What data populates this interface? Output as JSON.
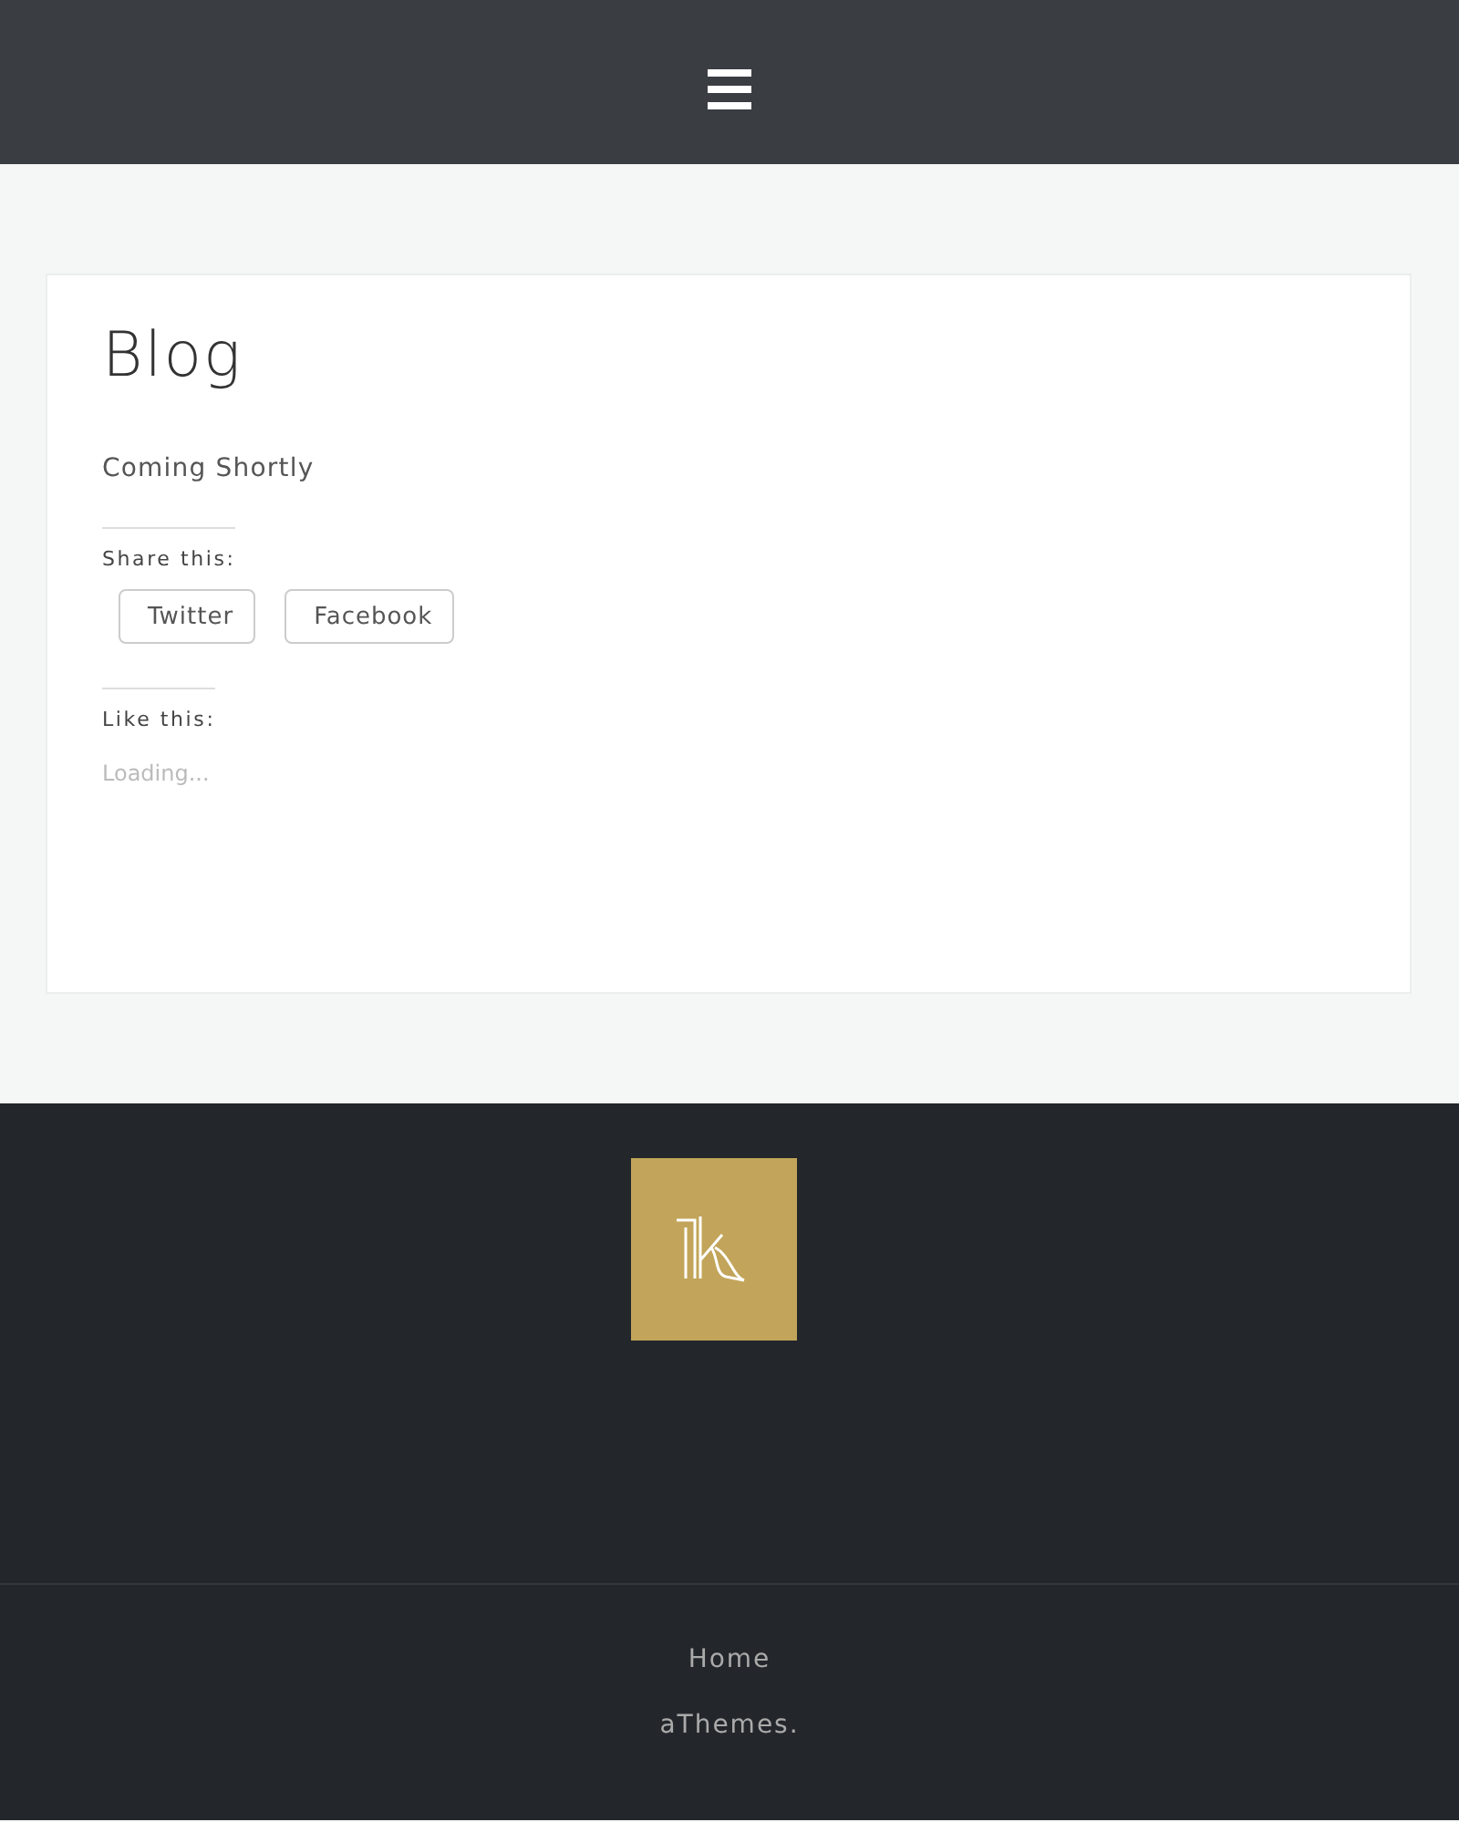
{
  "post": {
    "title": "Blog",
    "body": "Coming Shortly",
    "share": {
      "heading": "Share this:",
      "buttons": [
        "Twitter",
        "Facebook"
      ]
    },
    "likes": {
      "heading": "Like this:",
      "status": "Loading..."
    }
  },
  "footer": {
    "menu": [
      "Home"
    ],
    "credit": "aThemes."
  }
}
